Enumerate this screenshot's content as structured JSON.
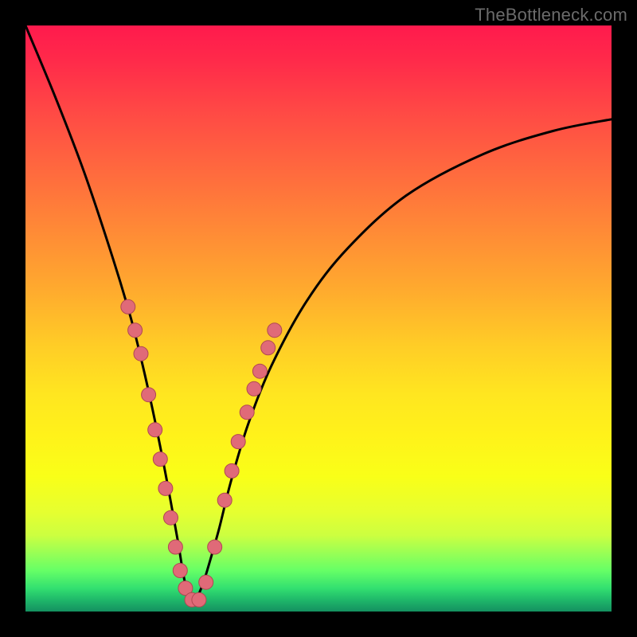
{
  "watermark": {
    "text": "TheBottleneck.com"
  },
  "colors": {
    "frame": "#000000",
    "curve_stroke": "#000000",
    "marker_fill": "#e06a78",
    "marker_stroke": "#b04852",
    "gradient_top": "#ff1a4d",
    "gradient_bottom": "#149060"
  },
  "chart_data": {
    "type": "line",
    "title": "",
    "xlabel": "",
    "ylabel": "",
    "xlim": [
      0,
      100
    ],
    "ylim": [
      0,
      100
    ],
    "grid": false,
    "legend": false,
    "description": "V-shaped bottleneck curve starting at top-left, plunging to a minimum near x≈28 at the bottom, then rising with diminishing slope toward upper right. Overlaid salmon markers highlight the lower portion of both branches.",
    "series": [
      {
        "name": "bottleneck-curve",
        "x": [
          0,
          5,
          10,
          15,
          18,
          20,
          22,
          24,
          26,
          27,
          28,
          29,
          30,
          31,
          33,
          35,
          38,
          42,
          48,
          55,
          65,
          78,
          90,
          100
        ],
        "values": [
          100,
          88,
          75,
          60,
          50,
          42,
          33,
          23,
          12,
          6,
          2,
          2,
          4,
          7,
          14,
          22,
          32,
          42,
          53,
          62,
          71,
          78,
          82,
          84
        ]
      }
    ],
    "markers": [
      {
        "x": 17.5,
        "y": 52
      },
      {
        "x": 18.7,
        "y": 48
      },
      {
        "x": 19.7,
        "y": 44
      },
      {
        "x": 21.0,
        "y": 37
      },
      {
        "x": 22.1,
        "y": 31
      },
      {
        "x": 23.0,
        "y": 26
      },
      {
        "x": 23.9,
        "y": 21
      },
      {
        "x": 24.8,
        "y": 16
      },
      {
        "x": 25.6,
        "y": 11
      },
      {
        "x": 26.4,
        "y": 7
      },
      {
        "x": 27.3,
        "y": 4
      },
      {
        "x": 28.4,
        "y": 2
      },
      {
        "x": 29.6,
        "y": 2
      },
      {
        "x": 30.8,
        "y": 5
      },
      {
        "x": 32.3,
        "y": 11
      },
      {
        "x": 34.0,
        "y": 19
      },
      {
        "x": 35.2,
        "y": 24
      },
      {
        "x": 36.3,
        "y": 29
      },
      {
        "x": 37.8,
        "y": 34
      },
      {
        "x": 39.0,
        "y": 38
      },
      {
        "x": 40.0,
        "y": 41
      },
      {
        "x": 41.4,
        "y": 45
      },
      {
        "x": 42.5,
        "y": 48
      }
    ]
  }
}
